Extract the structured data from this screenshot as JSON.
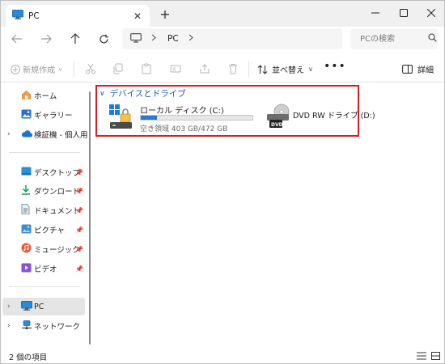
{
  "window": {
    "tab_title": "PC",
    "tab_close": "✕",
    "new_tab": "+",
    "controls": {
      "minimize": "—",
      "maximize": "☐",
      "close": "✕"
    }
  },
  "navigation": {
    "back_icon": "arrow-left-icon",
    "forward_icon": "arrow-right-icon",
    "up_icon": "arrow-up-icon",
    "refresh_icon": "refresh-icon",
    "breadcrumb": [
      "PC"
    ],
    "search_placeholder": "PCの検索"
  },
  "toolbar": {
    "new_label": "新規作成",
    "sort_label": "並べ替え",
    "more": "•••",
    "details_label": "詳細",
    "disabled_icons": [
      "cut-icon",
      "copy-icon",
      "paste-icon",
      "rename-icon",
      "share-icon",
      "delete-icon"
    ]
  },
  "sidebar": {
    "top_items": [
      {
        "label": "ホーム",
        "icon": "home-icon"
      },
      {
        "label": "ギャラリー",
        "icon": "gallery-icon"
      },
      {
        "label": "検証機 - 個人用",
        "icon": "onedrive-icon",
        "expandable": true
      }
    ],
    "quick_access": [
      {
        "label": "デスクトップ",
        "icon": "desktop-folder-icon",
        "pinned": true
      },
      {
        "label": "ダウンロード",
        "icon": "download-icon",
        "pinned": true
      },
      {
        "label": "ドキュメント",
        "icon": "documents-icon",
        "pinned": true
      },
      {
        "label": "ピクチャ",
        "icon": "pictures-icon",
        "pinned": true
      },
      {
        "label": "ミュージック",
        "icon": "music-icon",
        "pinned": true
      },
      {
        "label": "ビデオ",
        "icon": "videos-icon",
        "pinned": true
      }
    ],
    "bottom_items": [
      {
        "label": "PC",
        "icon": "pc-icon",
        "expandable": true,
        "selected": true
      },
      {
        "label": "ネットワーク",
        "icon": "network-icon",
        "expandable": true
      }
    ]
  },
  "content": {
    "group_title": "デバイスとドライブ",
    "drives": [
      {
        "name": "ローカル ディスク (C:)",
        "free_text": "空き領域 403 GB/472 GB",
        "used_fraction": 0.146,
        "icon": "windows-drive-icon"
      },
      {
        "name": "DVD RW ドライブ (D:)",
        "icon": "dvd-drive-icon",
        "badge": "DVD"
      }
    ]
  },
  "status": {
    "item_count": "2 個の項目"
  },
  "colors": {
    "accent": "#1a5fb4",
    "highlight_border": "#d32027",
    "usage_bar": "#2a79d3"
  }
}
